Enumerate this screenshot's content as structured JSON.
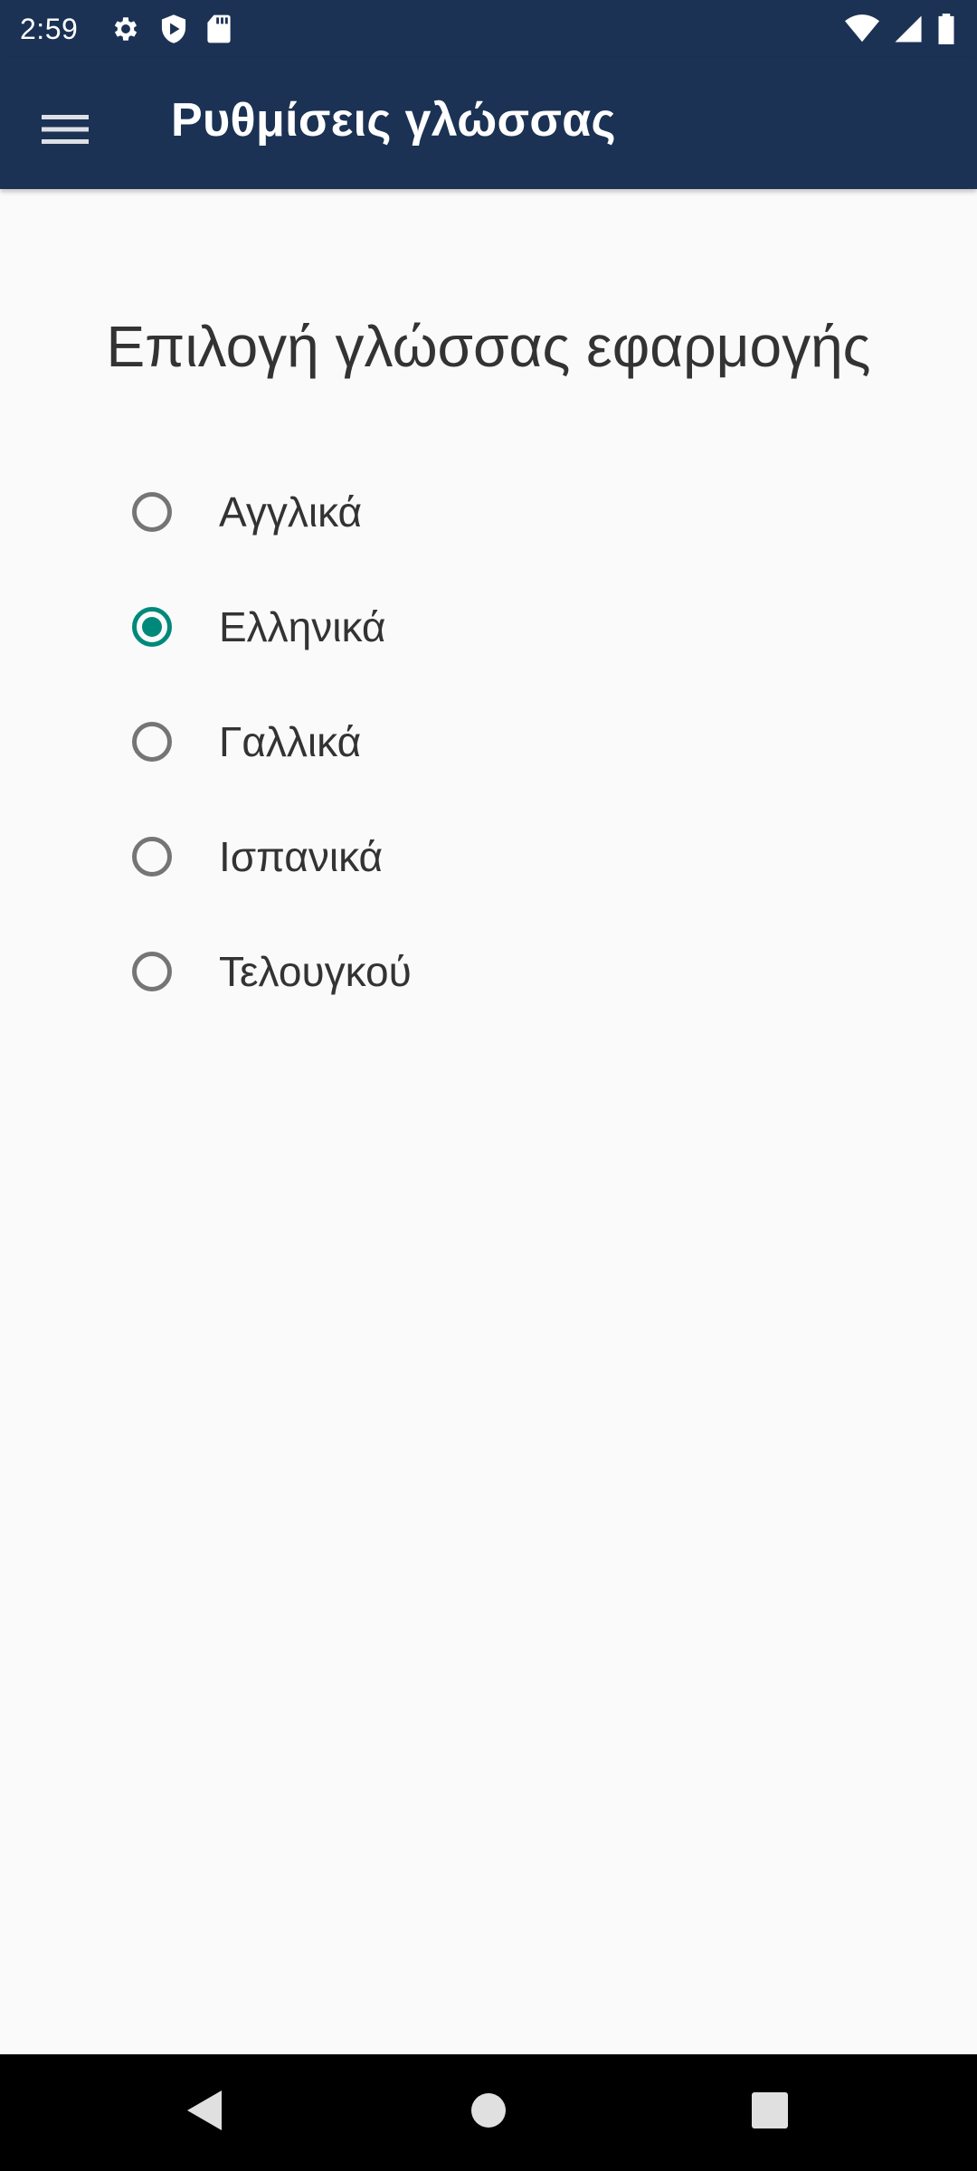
{
  "status_bar": {
    "time": "2:59",
    "left_icons": [
      "gear-icon",
      "shield-play-icon",
      "sd-card-icon"
    ],
    "right_icons": [
      "wifi-icon",
      "signal-icon",
      "battery-icon"
    ]
  },
  "app_bar": {
    "title": "Ρυθμίσεις γλώσσας",
    "menu_icon": "hamburger-menu-icon",
    "background_color": "#1b3254"
  },
  "main": {
    "section_title": "Επιλογή γλώσσας εφαρμογής",
    "selected_language": "Ελληνικά",
    "accent_color": "#00897b",
    "options": [
      {
        "label": "Αγγλικά",
        "checked": false
      },
      {
        "label": "Ελληνικά",
        "checked": true
      },
      {
        "label": "Γαλλικά",
        "checked": false
      },
      {
        "label": "Ισπανικά",
        "checked": false
      },
      {
        "label": "Τελουγκού",
        "checked": false
      }
    ]
  },
  "nav_bar": {
    "buttons": [
      "back-icon",
      "home-icon",
      "recents-icon"
    ]
  }
}
